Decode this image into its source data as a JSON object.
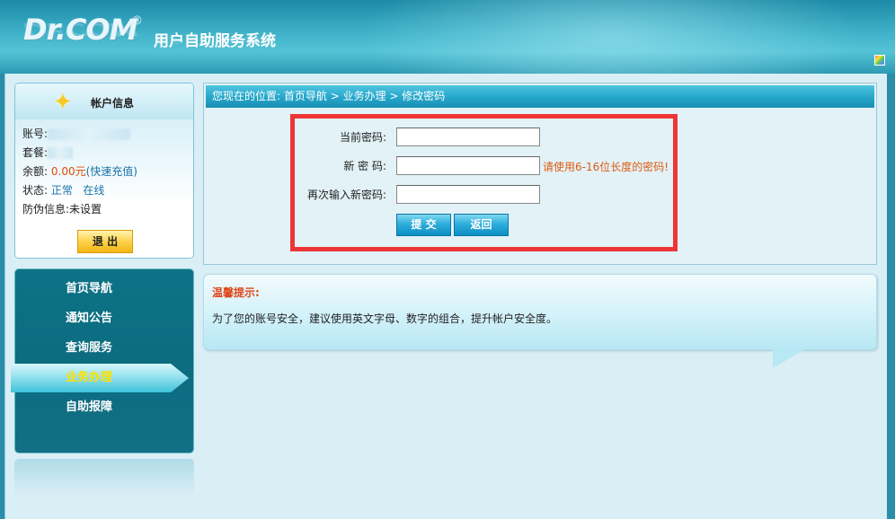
{
  "header": {
    "logo": "Dr.COM",
    "logo_reg": "®",
    "system_title": "用户自助服务系统"
  },
  "account": {
    "title": "帐户信息",
    "account_label": "账号:",
    "plan_label": "套餐:",
    "balance_label": "余额:",
    "balance_value": "0.00元",
    "recharge_link": "(快速充值)",
    "status_label": "状态:",
    "status_value": "正常",
    "online_value": "在线",
    "antifake_label": "防伪信息:",
    "antifake_value": "未设置",
    "logout_label": "退 出"
  },
  "nav": {
    "items": [
      {
        "label": "首页导航",
        "active": false
      },
      {
        "label": "通知公告",
        "active": false
      },
      {
        "label": "查询服务",
        "active": false
      },
      {
        "label": "业务办理",
        "active": true
      },
      {
        "label": "自助报障",
        "active": false
      }
    ]
  },
  "breadcrumb": {
    "prefix": "您现在的位置:",
    "path": "首页导航 > 业务办理 > 修改密码"
  },
  "form": {
    "current_password_label": "当前密码:",
    "new_password_label": "新 密 码:",
    "confirm_password_label": "再次输入新密码:",
    "current_password_value": "",
    "new_password_value": "",
    "confirm_password_value": "",
    "length_hint": "请使用6-16位长度的密码!",
    "submit_label": "提 交",
    "back_label": "返回"
  },
  "tips": {
    "title": "温馨提示:",
    "text": "为了您的账号安全，建议使用英文字母、数字的组合，提升帐户安全度。"
  },
  "colors": {
    "highlight_border": "#ee3535",
    "accent_blue": "#1a8fb5",
    "warning_orange": "#e05a10",
    "nav_active_text": "#ffe000"
  }
}
